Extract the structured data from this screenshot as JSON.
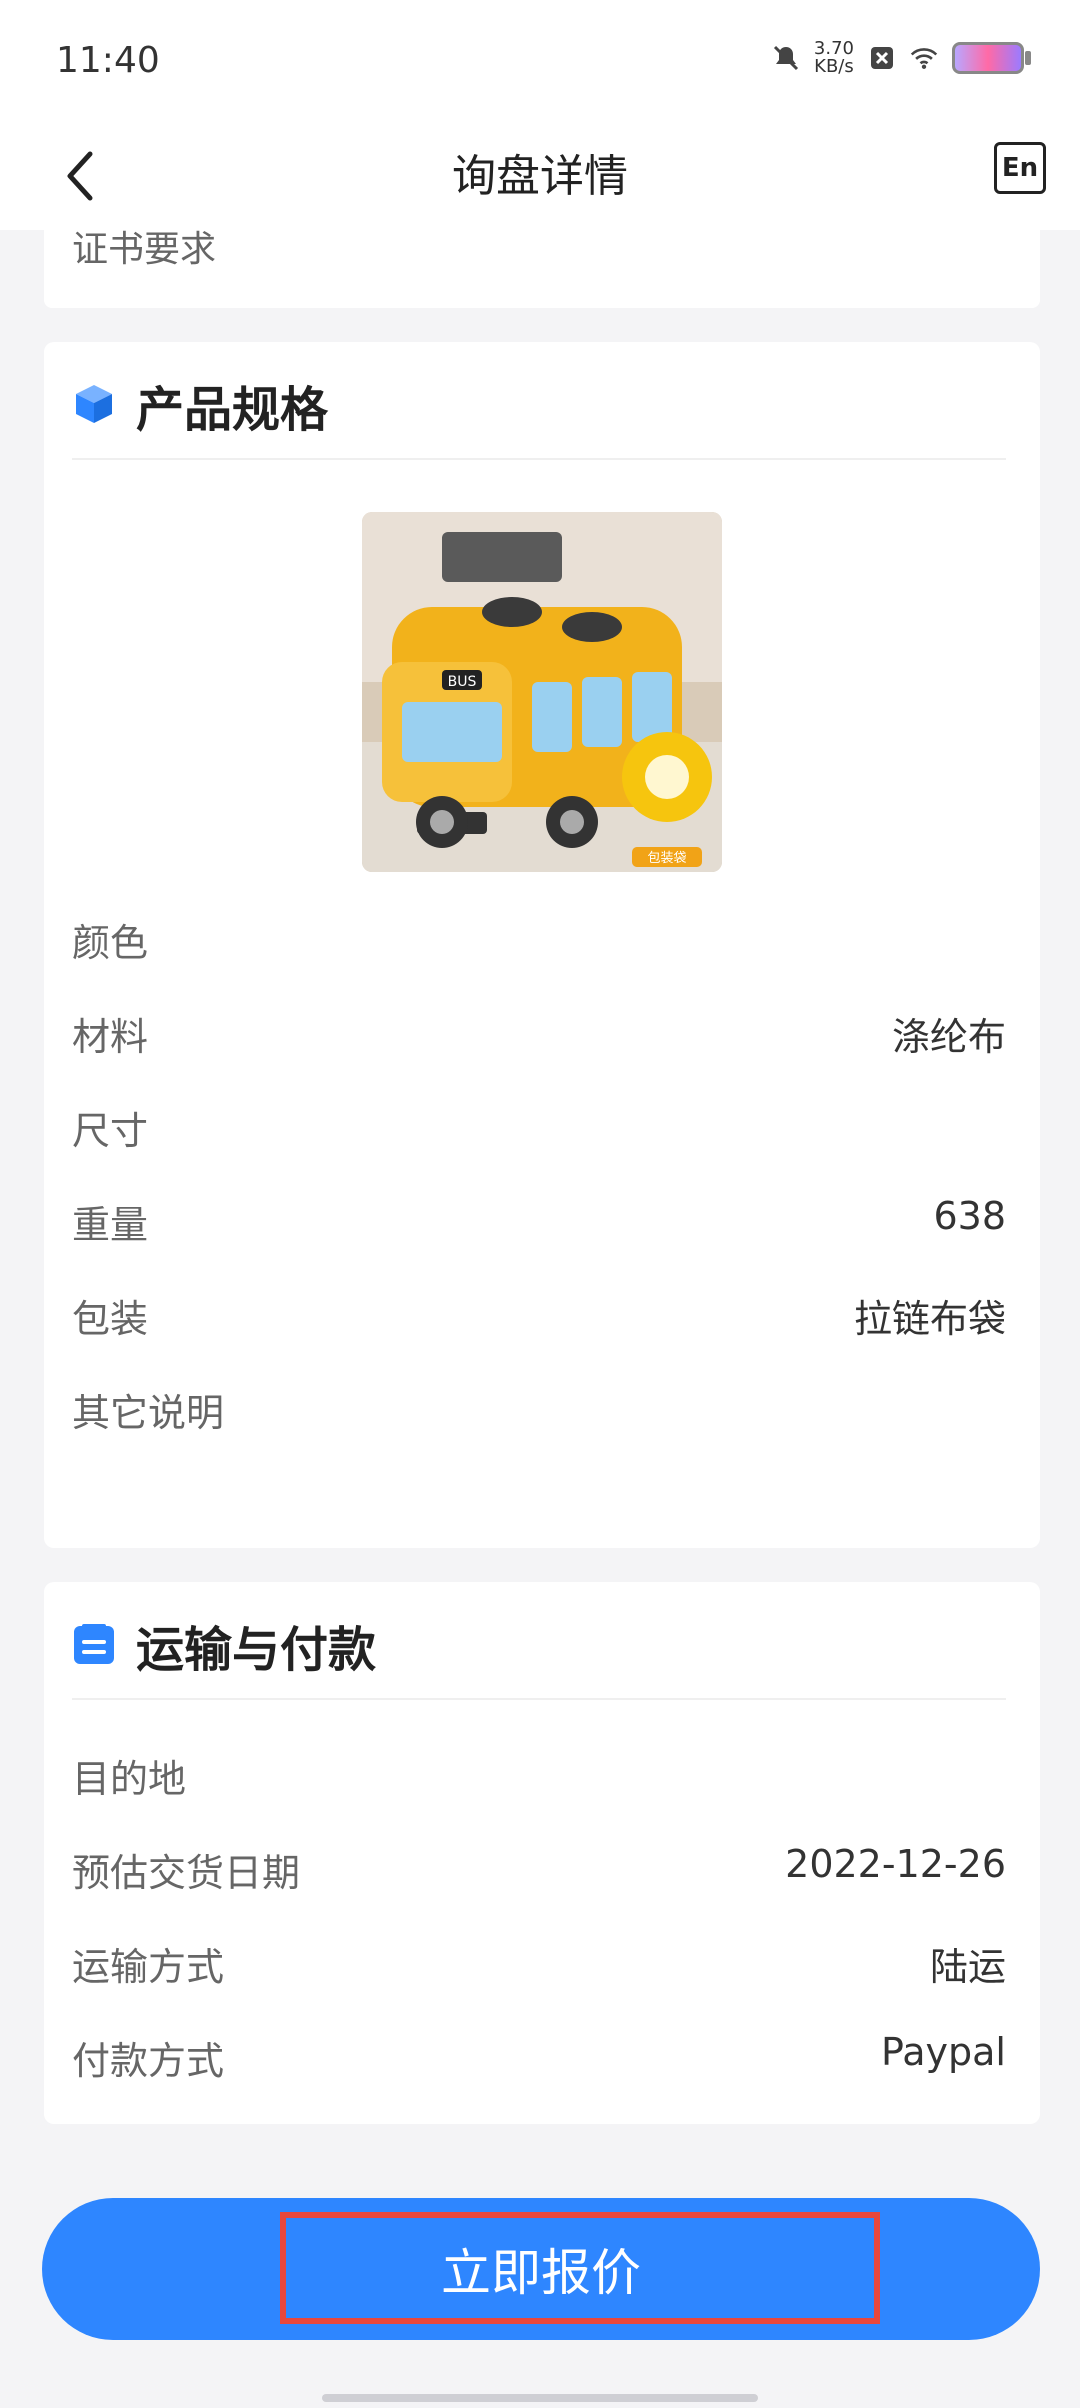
{
  "status_bar": {
    "time": "11:40",
    "net_speed_value": "3.70",
    "net_speed_unit": "KB/s"
  },
  "nav": {
    "title": "询盘详情",
    "lang_button": "En"
  },
  "top_card": {
    "certificate_label": "证书要求"
  },
  "spec": {
    "title": "产品规格",
    "rows": [
      {
        "label": "颜色",
        "value": ""
      },
      {
        "label": "材料",
        "value": "涤纶布"
      },
      {
        "label": "尺寸",
        "value": ""
      },
      {
        "label": "重量",
        "value": "638"
      },
      {
        "label": "包装",
        "value": "拉链布袋"
      },
      {
        "label": "其它说明",
        "value": ""
      }
    ],
    "image": {
      "bus_sign": "BUS",
      "bag_caption": "包装袋"
    }
  },
  "shipping": {
    "title": "运输与付款",
    "rows": [
      {
        "label": "目的地",
        "value": ""
      },
      {
        "label": "预估交货日期",
        "value": "2022-12-26"
      },
      {
        "label": "运输方式",
        "value": "陆运"
      },
      {
        "label": "付款方式",
        "value": "Paypal"
      }
    ]
  },
  "actions": {
    "quote_button": "立即报价"
  },
  "colors": {
    "primary": "#2e86ff",
    "highlight": "#e8473d",
    "background": "#f4f4f6"
  }
}
